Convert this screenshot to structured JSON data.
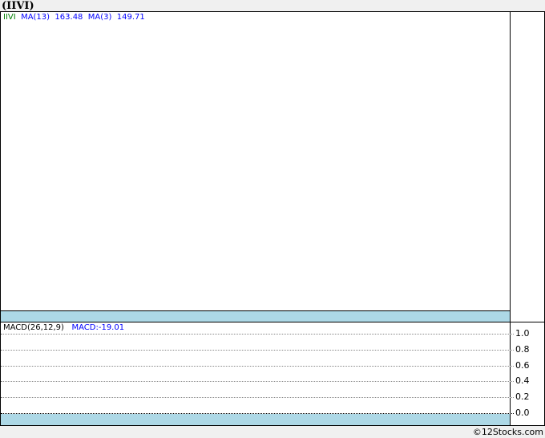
{
  "title": "(IIVI)",
  "price_legend": {
    "symbol": "IIVI",
    "ma13_label": "MA(13)",
    "ma13_value": "163.48",
    "ma3_label": "MA(3)",
    "ma3_value": "149.71",
    "symbol_color": "#008000",
    "ma_color": "#0000ff"
  },
  "macd_legend": {
    "label": "MACD(26,12,9)",
    "value": "MACD:-19.01"
  },
  "chart_data": [
    {
      "type": "line",
      "title": "(IIVI)",
      "series": [],
      "grid": false
    },
    {
      "type": "line",
      "title": "MACD(26,12,9)",
      "series": [],
      "ylim": [
        0,
        1.0
      ],
      "yticks": [
        "1.0",
        "0.8",
        "0.6",
        "0.4",
        "0.2",
        "0.0"
      ],
      "grid": true
    }
  ],
  "copyright": "©12Stocks.com",
  "colors": {
    "band": "#add8e6"
  }
}
